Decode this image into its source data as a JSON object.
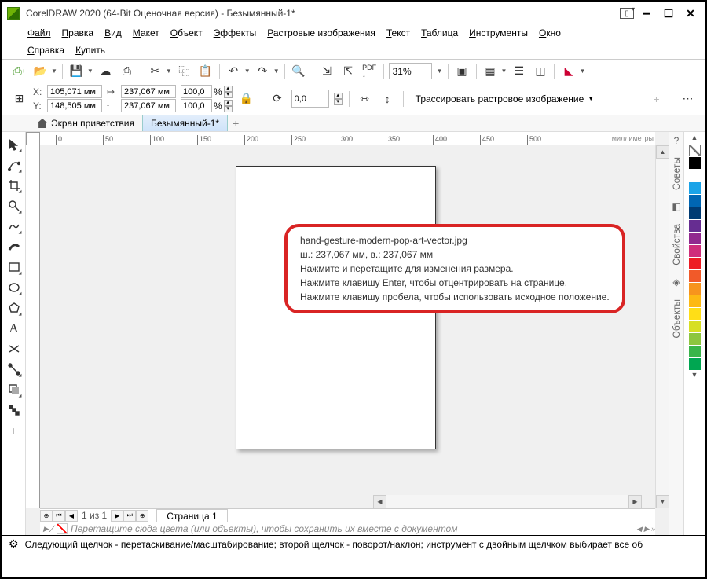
{
  "title": "CorelDRAW 2020 (64-Bit Оценочная версия) - Безымянный-1*",
  "menu": [
    "Файл",
    "Правка",
    "Вид",
    "Макет",
    "Объект",
    "Эффекты",
    "Растровые изображения",
    "Текст",
    "Таблица",
    "Инструменты",
    "Окно",
    "Справка",
    "Купить"
  ],
  "toolbar1": {
    "zoom": "31%"
  },
  "propbar": {
    "x": "105,071 мм",
    "y": "148,505 мм",
    "w": "237,067 мм",
    "h": "237,067 мм",
    "sx": "100,0",
    "sy": "100,0",
    "pct_lbl": "%",
    "rot": "0,0",
    "trace": "Трассировать растровое изображение"
  },
  "tabs": {
    "welcome": "Экран приветствия",
    "doc": "Безымянный-1*"
  },
  "ruler": {
    "ticks": [
      0,
      50,
      100,
      150,
      200,
      250,
      300,
      350
    ],
    "unit": "миллиметры"
  },
  "page": {
    "nav_of": "1 из 1",
    "tab_label": "Страница 1",
    "drop_hint": "Перетащите сюда цвета (или объекты), чтобы сохранить их вместе с документом"
  },
  "tooltip": {
    "l1": "hand-gesture-modern-pop-art-vector.jpg",
    "l2": "ш.: 237,067 мм, в.: 237,067 мм",
    "l3": "Нажмите и перетащите для изменения размера.",
    "l4": "Нажмите клавишу Enter, чтобы отцентрировать на странице.",
    "l5": "Нажмите клавишу пробела, чтобы использовать исходное положение."
  },
  "dockers": {
    "hints": "Советы",
    "props": "Свойства",
    "objs": "Объекты"
  },
  "palette": [
    "#000000",
    "#ffffff",
    "#1aa3e8",
    "#0066b3",
    "#003b73",
    "#662d91",
    "#91298f",
    "#cf2d7b",
    "#ed1c24",
    "#f15a29",
    "#f7941d",
    "#fdb913",
    "#ffde17",
    "#d7df23",
    "#8dc63f",
    "#39b54a",
    "#00a651"
  ],
  "status": "Следующий щелчок - перетаскивание/масштабирование; второй щелчок - поворот/наклон; инструмент с двойным щелчком выбирает все об"
}
